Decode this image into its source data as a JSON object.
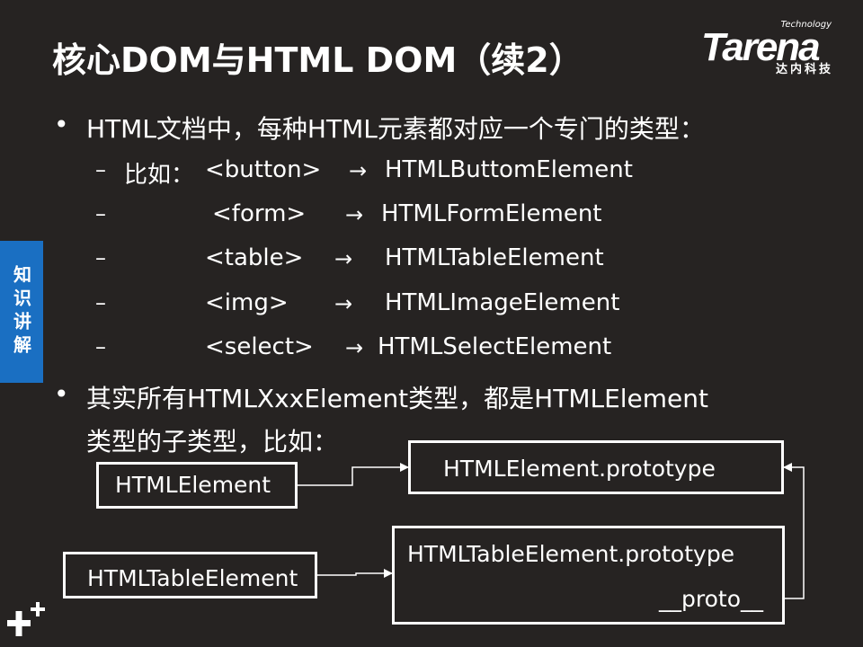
{
  "title": "核心DOM与HTML DOM（续2）",
  "logo": {
    "technology": "Technology",
    "brand": "Tarena",
    "sub": "达内科技"
  },
  "side_tab": "知识讲解",
  "bullets": [
    "HTML文档中，每种HTML元素都对应一个专门的类型：",
    "其实所有HTMLXxxElement类型，都是HTMLElement",
    "类型的子类型，比如："
  ],
  "bullet_marker": "•",
  "dash": "–",
  "arrow": "→",
  "mappings": [
    {
      "prefix": "比如：",
      "tag": "<button>",
      "type": "HTMLButtomElement"
    },
    {
      "prefix": "",
      "tag": "<form>",
      "type": "HTMLFormElement"
    },
    {
      "prefix": "",
      "tag": "<table>",
      "type": "HTMLTableElement"
    },
    {
      "prefix": "",
      "tag": "<img>",
      "type": "HTMLImageElement"
    },
    {
      "prefix": "",
      "tag": "<select>",
      "type": "HTMLSelectElement"
    }
  ],
  "diagram": {
    "html_element": "HTMLElement",
    "html_element_prototype": "HTMLElement.prototype",
    "html_table_element": "HTMLTableElement",
    "html_table_element_prototype": "HTMLTableElement.prototype",
    "proto": "__proto__"
  },
  "colors": {
    "background": "#262322",
    "side_tab": "#1a6fc2",
    "text": "#ffffff"
  },
  "icons": [
    "plus-logo-icon"
  ]
}
